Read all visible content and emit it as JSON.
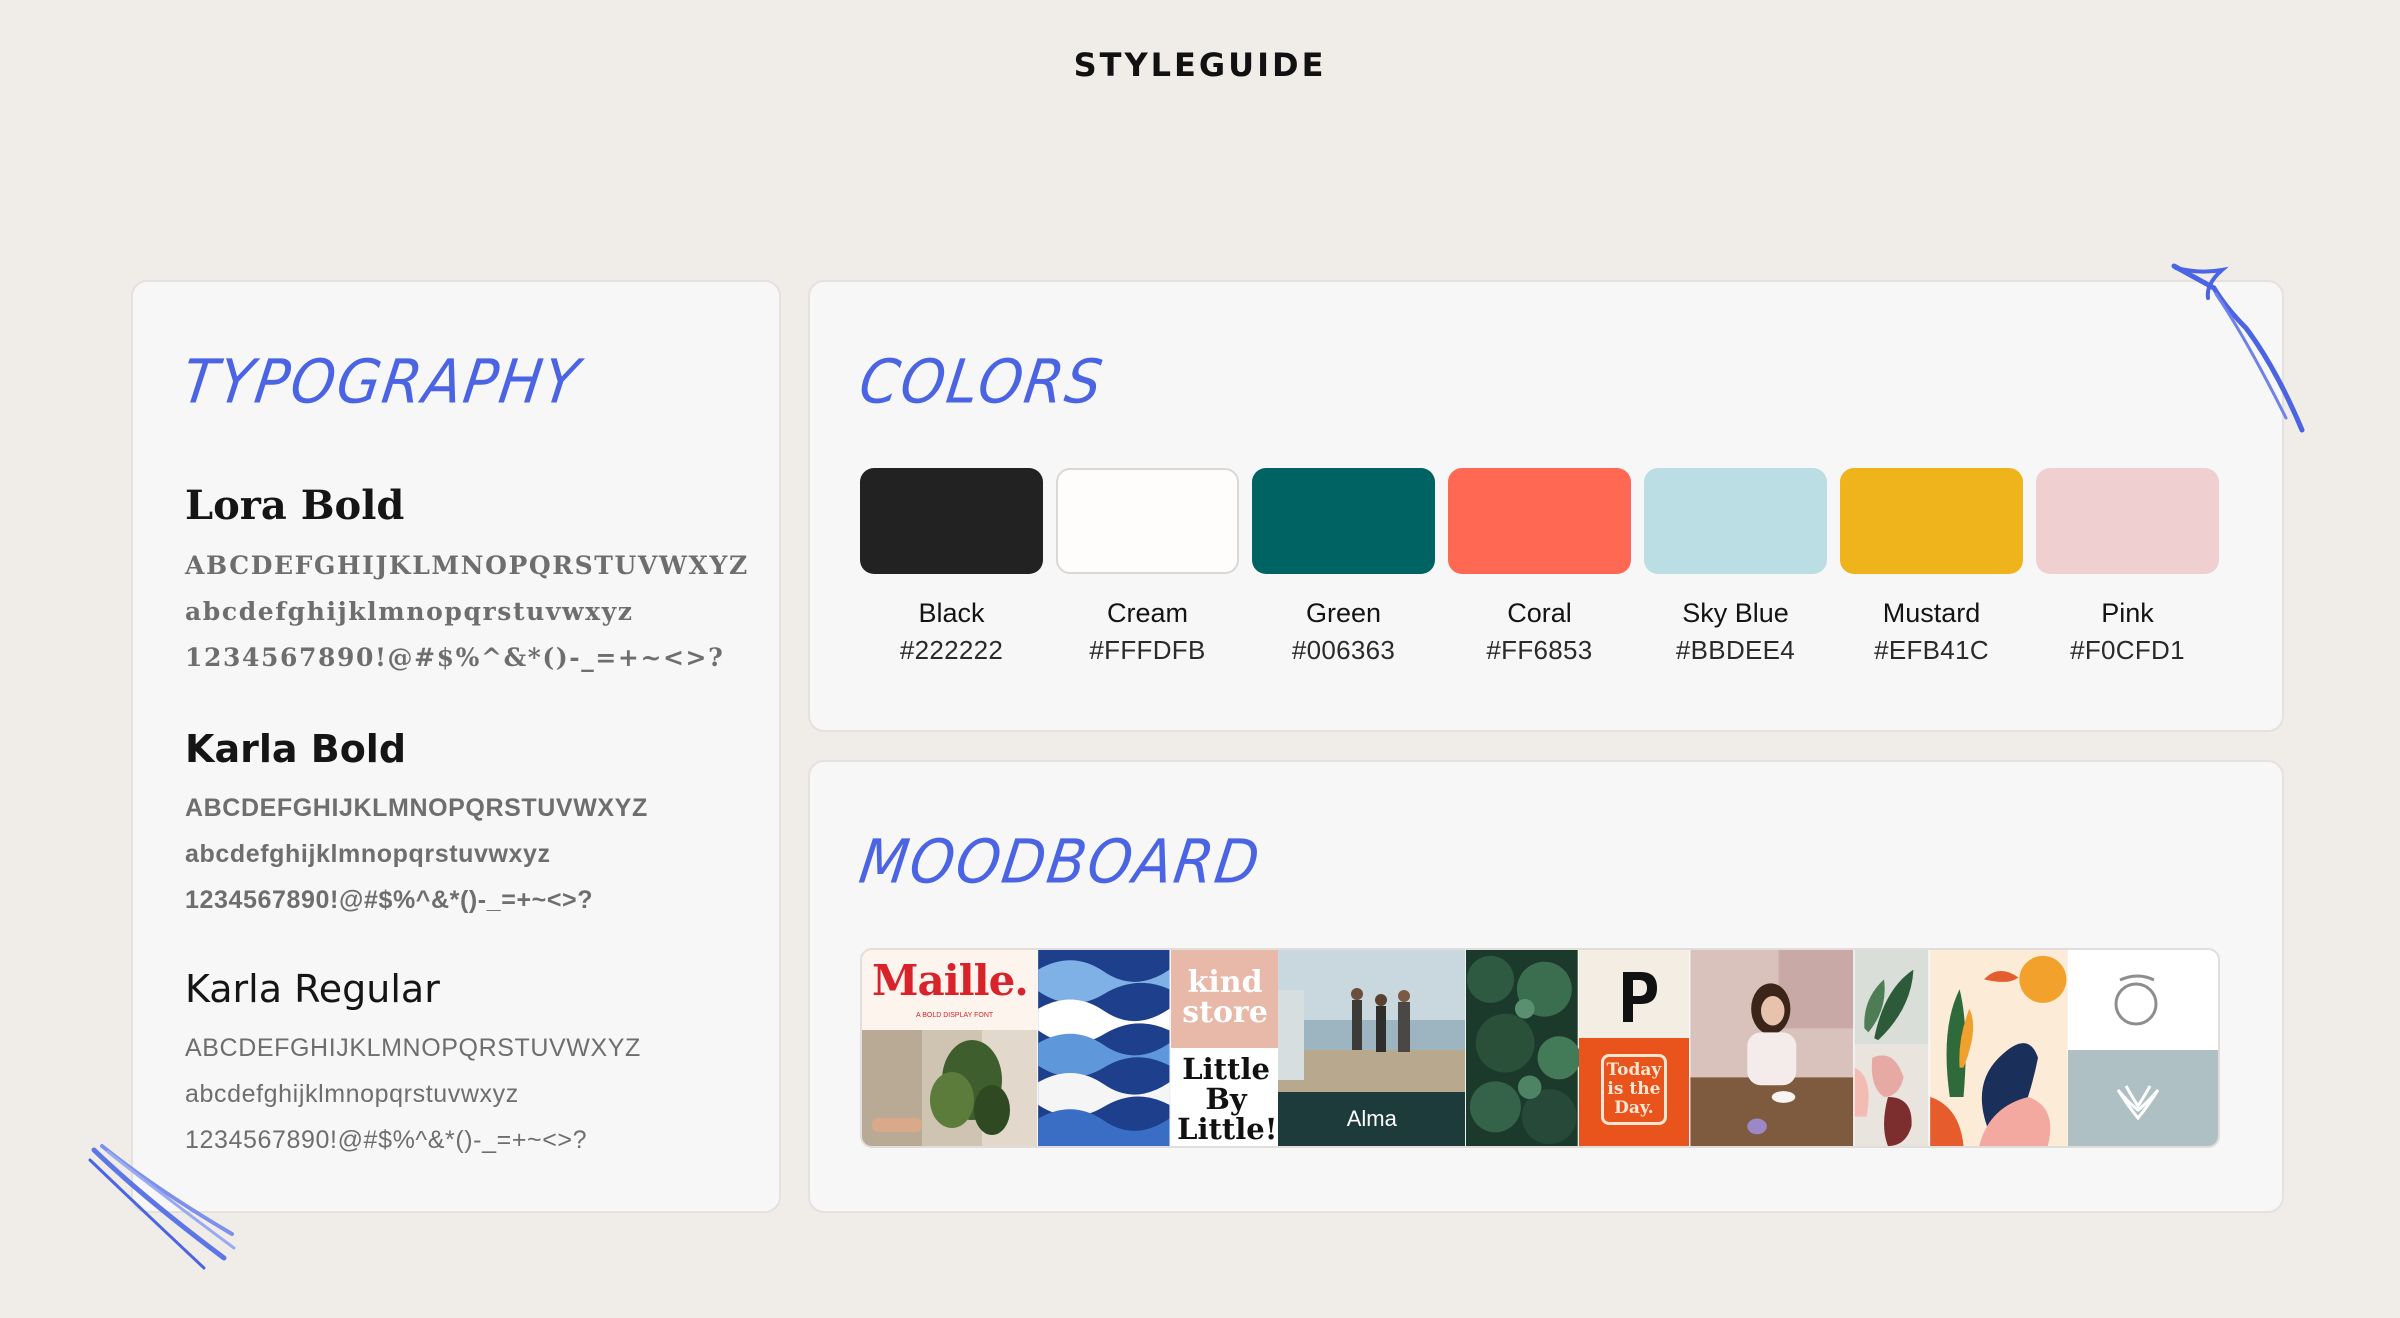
{
  "page": {
    "title": "STYLEGUIDE"
  },
  "typography": {
    "heading": "TYPOGRAPHY",
    "fonts": [
      {
        "name": "Lora Bold",
        "uppercase": "ABCDEFGHIJKLMNOPQRSTUVWXYZ",
        "lowercase": "abcdefghijklmnopqrstuvwxyz",
        "symbols": "1234567890!@#$%^&*()-_=+~<>?"
      },
      {
        "name": "Karla Bold",
        "uppercase": "ABCDEFGHIJKLMNOPQRSTUVWXYZ",
        "lowercase": "abcdefghijklmnopqrstuvwxyz",
        "symbols": "1234567890!@#$%^&*()-_=+~<>?"
      },
      {
        "name": "Karla Regular",
        "uppercase": "ABCDEFGHIJKLMNOPQRSTUVWXYZ",
        "lowercase": "abcdefghijklmnopqrstuvwxyz",
        "symbols": "1234567890!@#$%^&*()-_=+~<>?"
      }
    ]
  },
  "colors": {
    "heading": "COLORS",
    "swatches": [
      {
        "name": "Black",
        "hex": "#222222"
      },
      {
        "name": "Cream",
        "hex": "#FFFDFB"
      },
      {
        "name": "Green",
        "hex": "#006363"
      },
      {
        "name": "Coral",
        "hex": "#FF6853"
      },
      {
        "name": "Sky Blue",
        "hex": "#BBDEE4"
      },
      {
        "name": "Mustard",
        "hex": "#EFB41C"
      },
      {
        "name": "Pink",
        "hex": "#F0CFD1"
      }
    ]
  },
  "moodboard": {
    "heading": "MOODBOARD",
    "maille_title": "Maille.",
    "maille_subtitle": "A BOLD DISPLAY FONT",
    "kind_store": "kind store",
    "little_by_little": "Little By Little!",
    "alma": "Alma",
    "today_is_the_day": "Today is the Day."
  },
  "accent": "#4B64E4"
}
